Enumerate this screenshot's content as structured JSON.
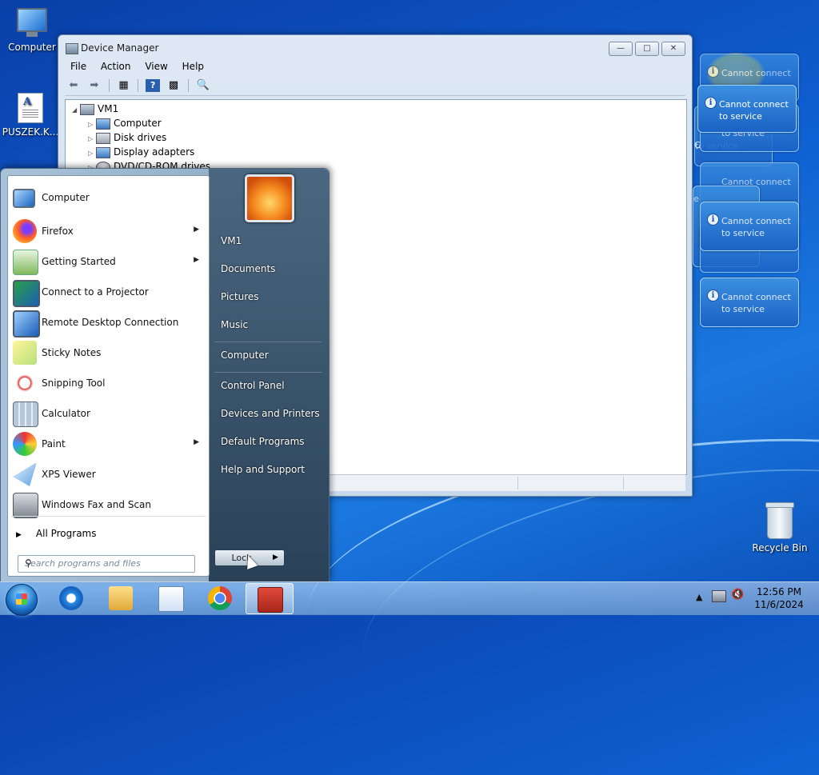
{
  "desktop": {
    "icons": [
      {
        "label": "Computer"
      },
      {
        "label": "PUSZEK.K..."
      },
      {
        "label": "Recycle Bin"
      }
    ]
  },
  "device_manager": {
    "title": "Device Manager",
    "menu": [
      "File",
      "Action",
      "View",
      "Help"
    ],
    "tree": {
      "root": "VM1",
      "children": [
        "Computer",
        "Disk drives",
        "Display adapters",
        "DVD/CD-ROM drives"
      ]
    }
  },
  "notifications": {
    "line1": "Cannot connect",
    "line2": "to service",
    "partial_line": "C",
    "partial_tail": "e"
  },
  "start_menu": {
    "programs": [
      {
        "label": "Computer",
        "has_submenu": false
      },
      {
        "label": "Firefox",
        "has_submenu": true
      },
      {
        "label": "Getting Started",
        "has_submenu": true
      },
      {
        "label": "Connect to a Projector",
        "has_submenu": false
      },
      {
        "label": "Remote Desktop Connection",
        "has_submenu": false
      },
      {
        "label": "Sticky Notes",
        "has_submenu": false
      },
      {
        "label": "Snipping Tool",
        "has_submenu": false
      },
      {
        "label": "Calculator",
        "has_submenu": false
      },
      {
        "label": "Paint",
        "has_submenu": true
      },
      {
        "label": "XPS Viewer",
        "has_submenu": false
      },
      {
        "label": "Windows Fax and Scan",
        "has_submenu": false
      }
    ],
    "all_programs": "All Programs",
    "search_placeholder": "Search programs and files",
    "right_links": [
      "VM1",
      "Documents",
      "Pictures",
      "Music",
      "Computer",
      "Control Panel",
      "Devices and Printers",
      "Default Programs",
      "Help and Support"
    ],
    "power_button": "Lock"
  },
  "taskbar": {
    "apps": [
      "internet-explorer",
      "windows-explorer",
      "wordpad",
      "chrome",
      "device-manager-toolbox"
    ],
    "clock_time": "12:56 PM",
    "clock_date": "11/6/2024"
  }
}
